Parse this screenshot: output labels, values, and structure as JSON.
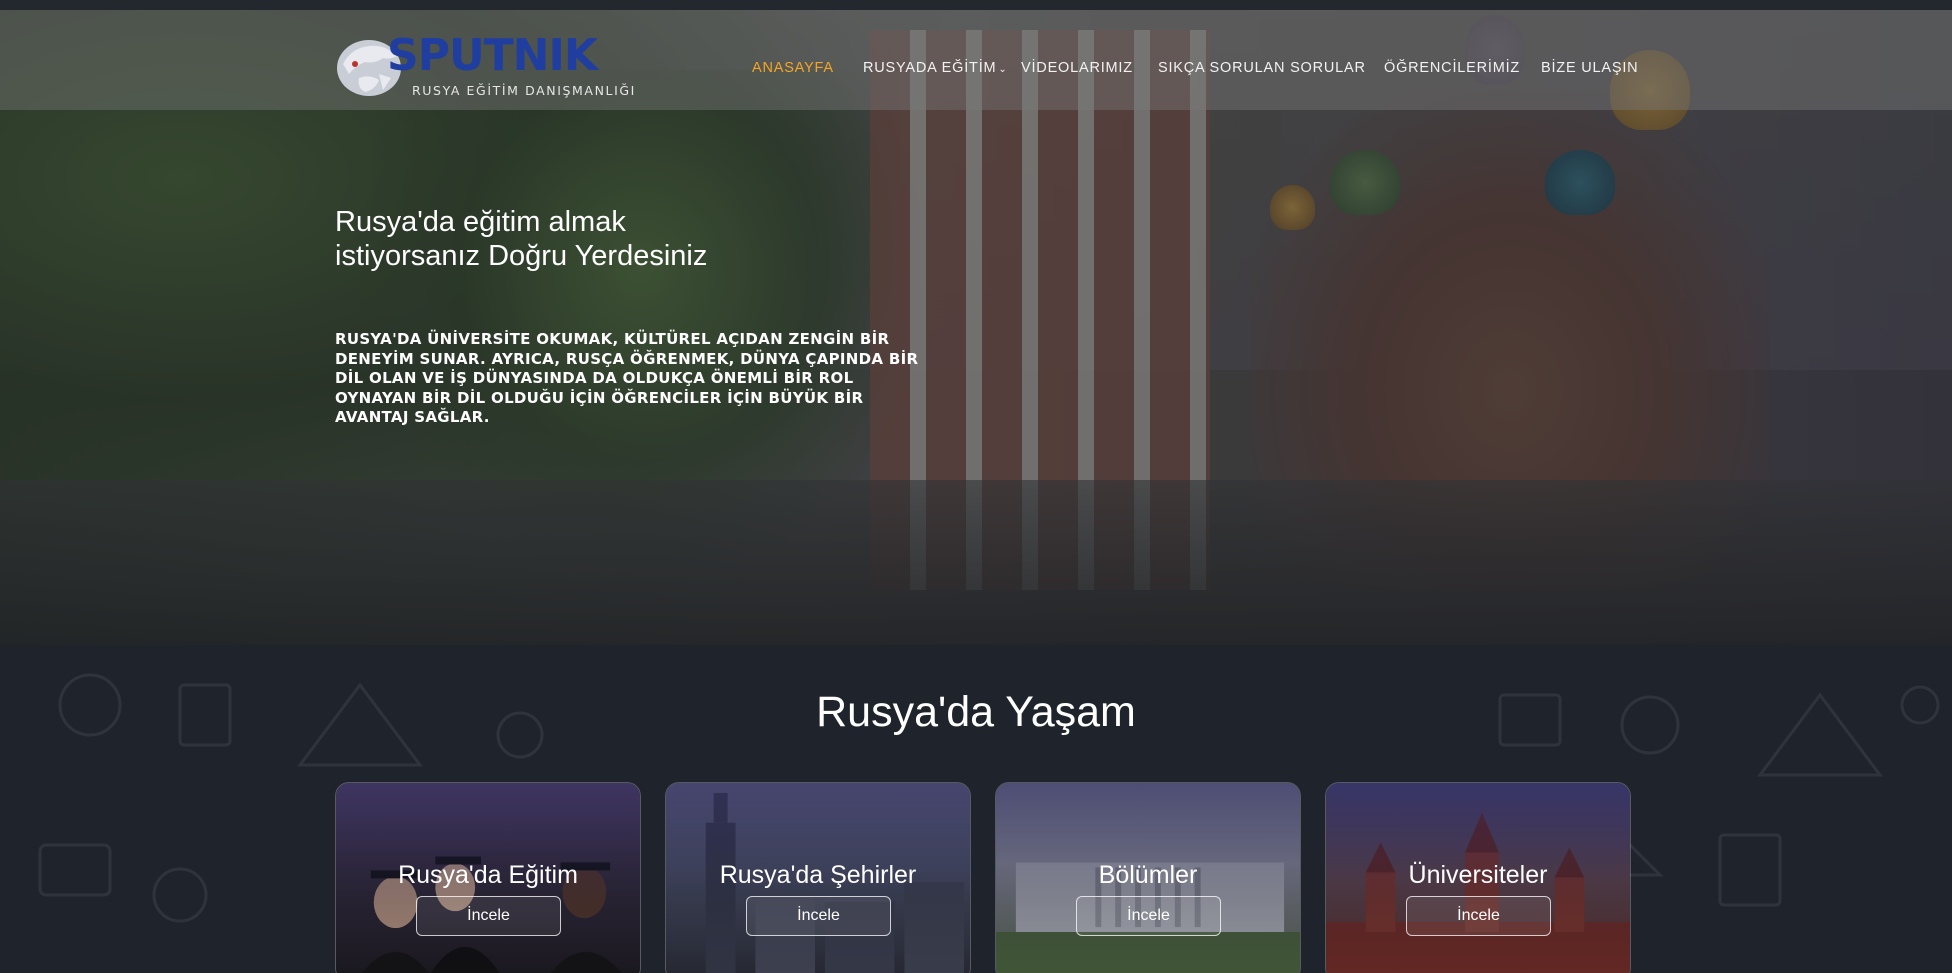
{
  "logo": {
    "brand": "SPUTNIK",
    "tagline": "RUSYA EĞİTİM DANIŞMANLIĞI"
  },
  "nav": {
    "items": [
      {
        "label": "ANASAYFA",
        "active": true
      },
      {
        "label": "RUSYADA EĞİTİM",
        "has_dropdown": true
      },
      {
        "label": "VİDEOLARIMIZ"
      },
      {
        "label": "SIKÇA SORULAN SORULAR"
      },
      {
        "label": "ÖĞRENCİLERİMİZ"
      },
      {
        "label": "BİZE ULAŞIN"
      }
    ]
  },
  "hero": {
    "title": "Rusya'da eğitim almak istiyorsanız Doğru Yerdesiniz",
    "subtitle": "RUSYA'DA ÜNİVERSİTE OKUMAK, KÜLTÜREL AÇIDAN ZENGİN BİR DENEYİM SUNAR. AYRICA, RUSÇA ÖĞRENMEK, DÜNYA ÇAPINDA BİR DİL OLAN VE İŞ DÜNYASINDA DA OLDUKÇA ÖNEMLİ BİR ROL OYNAYAN BİR DİL OLDUĞU İÇİN ÖĞRENCİLER İÇİN BÜYÜK BİR AVANTAJ SAĞLAR."
  },
  "section": {
    "title": "Rusya'da Yaşam",
    "cards": [
      {
        "title": "Rusya'da Eğitim",
        "button": "İncele"
      },
      {
        "title": "Rusya'da Şehirler",
        "button": "İncele"
      },
      {
        "title": "Bölümler",
        "button": "İncele"
      },
      {
        "title": "Üniversiteler",
        "button": "İncele"
      }
    ]
  },
  "colors": {
    "accent": "#f5a623",
    "brand": "#1f3ea0",
    "background": "#1f242c"
  }
}
